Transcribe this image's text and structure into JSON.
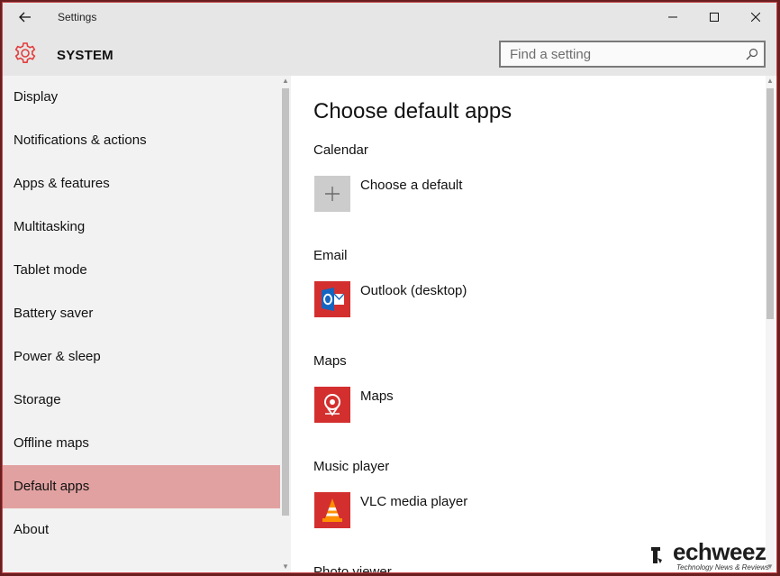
{
  "window": {
    "title": "Settings"
  },
  "header": {
    "section": "SYSTEM",
    "search_placeholder": "Find a setting"
  },
  "sidebar": {
    "items": [
      {
        "label": "Display"
      },
      {
        "label": "Notifications & actions"
      },
      {
        "label": "Apps & features"
      },
      {
        "label": "Multitasking"
      },
      {
        "label": "Tablet mode"
      },
      {
        "label": "Battery saver"
      },
      {
        "label": "Power & sleep"
      },
      {
        "label": "Storage"
      },
      {
        "label": "Offline maps"
      },
      {
        "label": "Default apps",
        "selected": true
      },
      {
        "label": "About"
      }
    ]
  },
  "main": {
    "title": "Choose default apps",
    "groups": [
      {
        "label": "Calendar",
        "app": "Choose a default",
        "icon": "plus-icon"
      },
      {
        "label": "Email",
        "app": "Outlook (desktop)",
        "icon": "outlook-icon"
      },
      {
        "label": "Maps",
        "app": "Maps",
        "icon": "maps-icon"
      },
      {
        "label": "Music player",
        "app": "VLC media player",
        "icon": "vlc-icon"
      },
      {
        "label": "Photo viewer"
      }
    ]
  },
  "watermark": {
    "brand": "echweez",
    "tagline": "Technology News & Reviews"
  },
  "colors": {
    "accent": "#e33d3d",
    "selected_bg": "#e2a1a1",
    "header_bg": "#e6e6e6",
    "sidebar_bg": "#f2f2f2",
    "tile_red": "#d32f2f",
    "tile_gray": "#cccccc"
  }
}
